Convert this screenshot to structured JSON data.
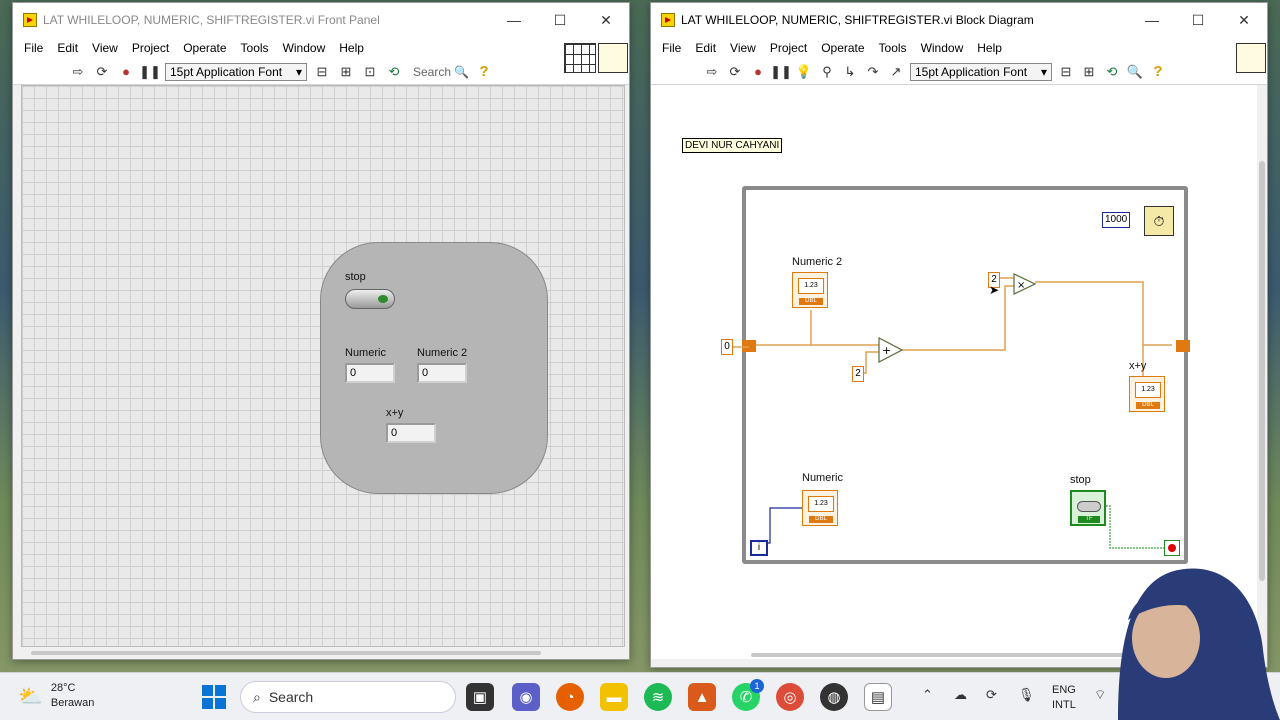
{
  "front_panel": {
    "title": "LAT WHILELOOP, NUMERIC, SHIFTREGISTER.vi Front Panel",
    "menu": [
      "File",
      "Edit",
      "View",
      "Project",
      "Operate",
      "Tools",
      "Window",
      "Help"
    ],
    "font": "15pt Application Font",
    "search": "Search",
    "controls": {
      "stop_label": "stop",
      "numeric_label": "Numeric",
      "numeric_value": "0",
      "numeric2_label": "Numeric 2",
      "numeric2_value": "0",
      "xy_label": "x+y",
      "xy_value": "0"
    }
  },
  "block_diagram": {
    "title": "LAT WHILELOOP, NUMERIC, SHIFTREGISTER.vi Block Diagram",
    "menu": [
      "File",
      "Edit",
      "View",
      "Project",
      "Operate",
      "Tools",
      "Window",
      "Help"
    ],
    "font": "15pt Application Font",
    "label_box": "DEVI NUR CAHYANI",
    "wait_ms": "1000",
    "numeric2_label": "Numeric 2",
    "numeric_label": "Numeric",
    "xy_label": "x+y",
    "stop_label": "stop",
    "const_init": "0",
    "const_add": "2",
    "const_mult": "2",
    "iter_label": "i",
    "num_glyph": "1.23",
    "dbl_tag": "DBL",
    "tf_tag": "TF"
  },
  "taskbar": {
    "temp": "28°C",
    "weather": "Berawan",
    "search": "Search",
    "lang1": "ENG",
    "lang2": "INTL",
    "whatsapp_badge": "1"
  }
}
